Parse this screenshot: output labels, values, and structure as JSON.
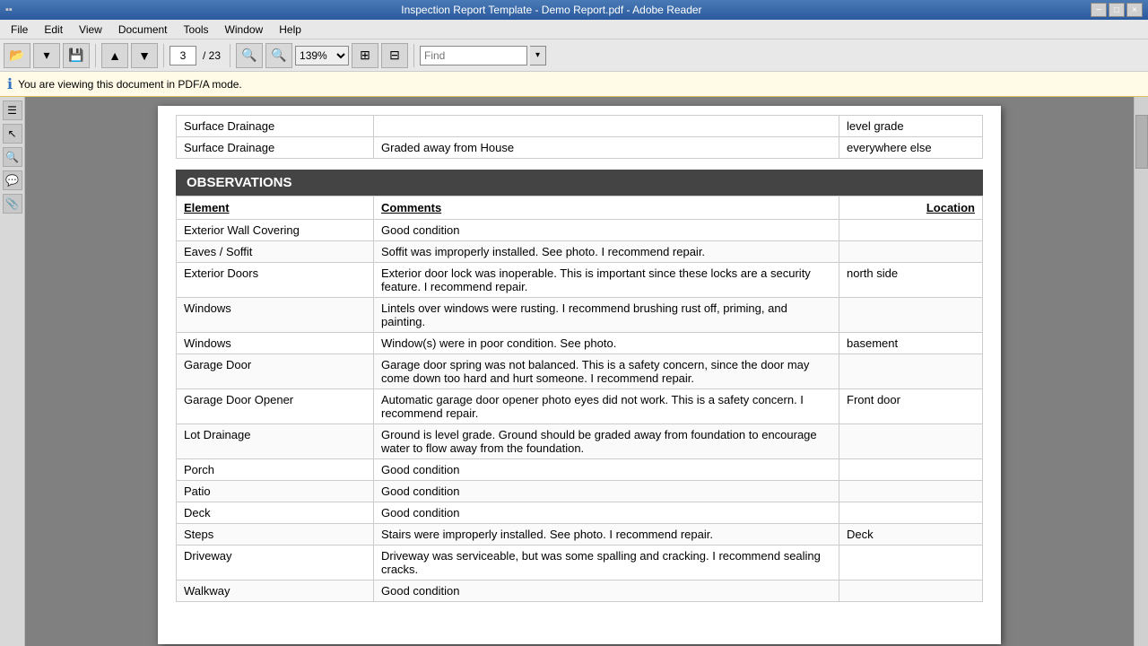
{
  "titleBar": {
    "text": "Inspection Report Template - Demo Report.pdf - Adobe Reader",
    "buttons": [
      "−",
      "□",
      "×"
    ]
  },
  "menuBar": {
    "items": [
      "File",
      "Edit",
      "View",
      "Document",
      "Tools",
      "Window",
      "Help"
    ]
  },
  "toolbar": {
    "pageNum": "3",
    "pageTotal": "/ 23",
    "zoom": "139%",
    "findPlaceholder": "Find"
  },
  "infoBar": {
    "text": "You are viewing this document in PDF/A mode."
  },
  "partialRows": [
    {
      "element": "Surface Drainage",
      "comment": "",
      "location": "level grade"
    },
    {
      "element": "Surface Drainage",
      "comment": "Graded away from House",
      "location": "everywhere else"
    }
  ],
  "observations": {
    "header": "OBSERVATIONS",
    "columns": {
      "element": "Element",
      "comments": "Comments",
      "location": "Location"
    },
    "rows": [
      {
        "element": "Exterior Wall Covering",
        "comment": "Good condition",
        "location": ""
      },
      {
        "element": "Eaves / Soffit",
        "comment": "Soffit was improperly installed. See photo. I recommend repair.",
        "location": ""
      },
      {
        "element": "Exterior Doors",
        "comment": "Exterior door lock was inoperable. This is important since these locks are a security feature. I recommend repair.",
        "location": "north side"
      },
      {
        "element": "Windows",
        "comment": "Lintels over windows were rusting.  I recommend brushing rust off, priming, and painting.",
        "location": ""
      },
      {
        "element": "Windows",
        "comment": "Window(s) were in poor condition.  See photo.",
        "location": "basement"
      },
      {
        "element": "Garage Door",
        "comment": "Garage door spring was not balanced.  This is a safety concern, since the door may come down too hard and hurt someone. I recommend repair.",
        "location": ""
      },
      {
        "element": "Garage Door Opener",
        "comment": "Automatic garage door opener photo eyes did not work.  This is a safety concern.  I recommend repair.",
        "location": "Front door"
      },
      {
        "element": "Lot Drainage",
        "comment": "Ground is level grade.  Ground should be graded away from foundation to encourage water to flow away from the foundation.",
        "location": ""
      },
      {
        "element": "Porch",
        "comment": "Good condition",
        "location": ""
      },
      {
        "element": "Patio",
        "comment": "Good condition",
        "location": ""
      },
      {
        "element": "Deck",
        "comment": "Good condition",
        "location": ""
      },
      {
        "element": "Steps",
        "comment": "Stairs were improperly installed.  See photo. I recommend repair.",
        "location": "Deck"
      },
      {
        "element": "Driveway",
        "comment": "Driveway was serviceable, but was some spalling and cracking.  I recommend sealing cracks.",
        "location": ""
      },
      {
        "element": "Walkway",
        "comment": "Good condition",
        "location": ""
      }
    ]
  }
}
